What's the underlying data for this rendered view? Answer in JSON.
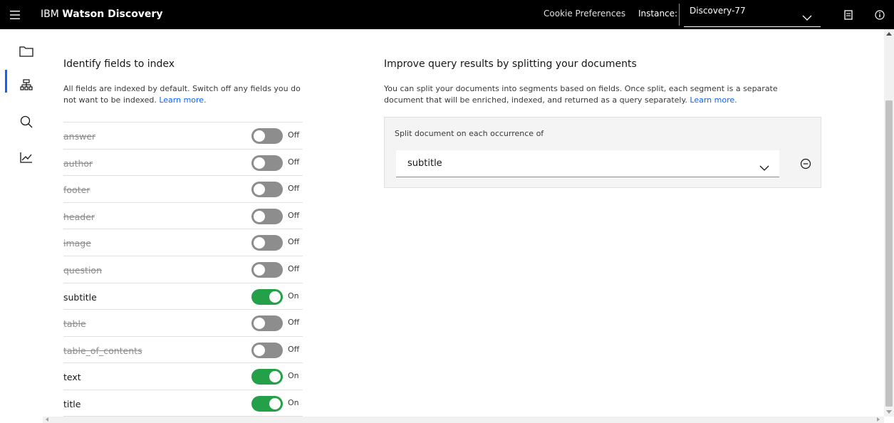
{
  "header": {
    "brand_prefix": "IBM",
    "brand_name": "Watson Discovery",
    "cookie_preferences": "Cookie Preferences",
    "instance_label": "Instance:",
    "instance_value": "Discovery-77",
    "icons": {
      "menu": "hamburger-menu-icon",
      "docs": "document-icon",
      "info": "info-icon",
      "instance_dropdown": "chevron-down-icon"
    }
  },
  "rail": {
    "items": [
      {
        "name": "folder-icon",
        "active": true
      },
      {
        "name": "hierarchy-icon",
        "active": false
      },
      {
        "name": "search-icon",
        "active": false
      },
      {
        "name": "analytics-icon",
        "active": false
      }
    ],
    "accent": "#0f62fe"
  },
  "index": {
    "title": "Identify fields to index",
    "description": "All fields are indexed by default. Switch off any fields you do not want to be indexed.",
    "learn_more": "Learn more.",
    "on_label": "On",
    "off_label": "Off",
    "fields": [
      {
        "name": "answer",
        "on": false
      },
      {
        "name": "author",
        "on": false
      },
      {
        "name": "footer",
        "on": false
      },
      {
        "name": "header",
        "on": false
      },
      {
        "name": "image",
        "on": false
      },
      {
        "name": "question",
        "on": false
      },
      {
        "name": "subtitle",
        "on": true
      },
      {
        "name": "table",
        "on": false
      },
      {
        "name": "table_of_contents",
        "on": false
      },
      {
        "name": "text",
        "on": true
      },
      {
        "name": "title",
        "on": true
      }
    ],
    "colors": {
      "on": "#24a148",
      "off": "#8d8d8d"
    }
  },
  "split": {
    "title": "Improve query results by splitting your documents",
    "description": "You can split your documents into segments based on fields. Once split, each segment is a separate document that will be enriched, indexed, and returned as a query separately.",
    "learn_more": "Learn more.",
    "select_label": "Split document on each occurrence of",
    "select_value": "subtitle",
    "icons": {
      "dropdown": "chevron-down-icon",
      "remove": "subtract-circle-icon"
    }
  }
}
